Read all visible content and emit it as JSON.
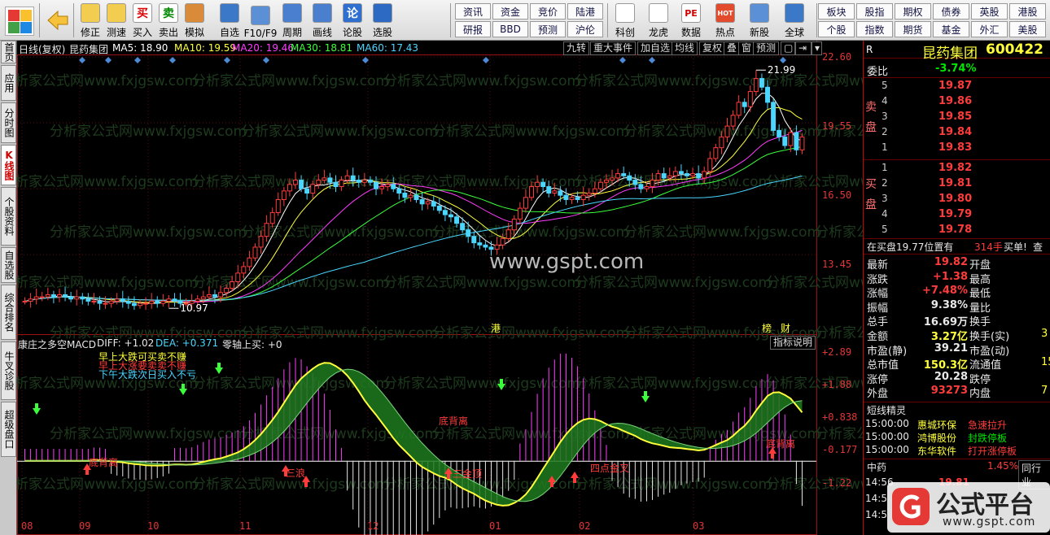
{
  "toolbar": {
    "buttons": [
      {
        "label": "修正",
        "icon": "arrow-up-icon"
      },
      {
        "label": "测速",
        "icon": "clock-icon"
      },
      {
        "label": "买入",
        "icon": "buy-icon",
        "glyph": "买"
      },
      {
        "label": "卖出",
        "icon": "sell-icon",
        "glyph": "卖"
      },
      {
        "label": "模拟",
        "icon": "hammer-icon"
      },
      {
        "label": "自选",
        "icon": "star-icon"
      },
      {
        "label": "F10/F9",
        "icon": "f10-icon"
      },
      {
        "label": "周期",
        "icon": "period-icon"
      },
      {
        "label": "画线",
        "icon": "pencil-icon"
      },
      {
        "label": "论股",
        "icon": "discuss-icon",
        "glyph": "论"
      },
      {
        "label": "选股",
        "icon": "gauge-icon"
      }
    ],
    "quick_top": [
      "资讯",
      "资金",
      "竞价",
      "陆港"
    ],
    "quick_bottom": [
      "研报",
      "BBD",
      "预测",
      "沪伦"
    ],
    "buttons2": [
      {
        "label": "科创",
        "icon": "chart-icon"
      },
      {
        "label": "龙虎",
        "icon": "dragon-icon"
      },
      {
        "label": "数据",
        "icon": "pe-icon",
        "glyph": "PE"
      },
      {
        "label": "热点",
        "icon": "hot-icon",
        "glyph": "HOT"
      },
      {
        "label": "新股",
        "icon": "ipo-icon"
      },
      {
        "label": "全球",
        "icon": "globe-icon"
      }
    ],
    "right_top": [
      "板块",
      "股指",
      "期权",
      "债券",
      "英股",
      "港股"
    ],
    "right_bottom": [
      "个股",
      "指数",
      "期货",
      "基金",
      "外汇",
      "美股"
    ]
  },
  "left_tabs": [
    "首页",
    "应用",
    "分时图",
    "K线图",
    "个股资料",
    "自选股",
    "综合排名",
    "牛叉诊股",
    "超级盘口"
  ],
  "chart_header": {
    "period": "日线(复权)",
    "stock": "昆药集团",
    "ma": [
      {
        "label": "MA5: 18.90",
        "color": "#ffffff"
      },
      {
        "label": "MA10: 19.59",
        "color": "#ffff3c"
      },
      {
        "label": "MA20: 19.46",
        "color": "#ff3cff"
      },
      {
        "label": "MA30: 18.81",
        "color": "#3cff3c"
      },
      {
        "label": "MA60: 17.43",
        "color": "#4ad6ff"
      }
    ],
    "buttons": [
      "九转",
      "重大事件",
      "加自选",
      "均线",
      "复权",
      "叠",
      "窗",
      "预测"
    ],
    "watermark": "www.gspt.com",
    "faint_watermark": "分析家公式网www.fxjgsw.com",
    "max_label": "21.99",
    "min_label": "10.97",
    "event_markers": [
      "港",
      "榜",
      "财"
    ]
  },
  "chart_data": [
    {
      "type": "candlestick",
      "title": "日线(复权) 昆药集团",
      "y_ticks": [
        "22.60",
        "19.55",
        "16.50",
        "13.45"
      ],
      "ylim": [
        10.0,
        22.6
      ],
      "x_ticks": [
        "08",
        "09",
        "10",
        "11",
        "12",
        "01",
        "02",
        "03"
      ],
      "series": [
        {
          "name": "MA5",
          "last": 18.9
        },
        {
          "name": "MA10",
          "last": 19.59
        },
        {
          "name": "MA20",
          "last": 19.46
        },
        {
          "name": "MA30",
          "last": 18.81
        },
        {
          "name": "MA60",
          "last": 17.43
        }
      ],
      "close": [
        11.3,
        11.4,
        11.5,
        11.5,
        11.6,
        11.5,
        11.6,
        11.5,
        11.4,
        11.5,
        11.4,
        11.3,
        11.3,
        11.2,
        11.2,
        11.3,
        11.4,
        11.3,
        11.2,
        11.1,
        11.2,
        11.2,
        11.3,
        11.2,
        11.3,
        11.4,
        11.3,
        11.2,
        11.2,
        11.3,
        11.4,
        11.5,
        11.6,
        11.5,
        11.7,
        11.9,
        12.2,
        12.6,
        12.9,
        13.3,
        13.8,
        14.3,
        14.9,
        15.4,
        16.0,
        16.4,
        16.7,
        16.9,
        16.5,
        16.3,
        16.7,
        16.9,
        17.0,
        16.8,
        16.6,
        16.9,
        17.1,
        16.9,
        16.8,
        16.9,
        16.8,
        16.5,
        16.6,
        16.7,
        16.5,
        16.3,
        16.1,
        16.2,
        16.0,
        15.8,
        15.9,
        15.7,
        15.5,
        15.3,
        15.2,
        14.9,
        14.6,
        14.3,
        14.0,
        13.9,
        13.8,
        13.7,
        13.9,
        14.2,
        14.6,
        15.1,
        15.6,
        16.1,
        16.6,
        16.8,
        16.6,
        16.3,
        16.4,
        16.2,
        16.0,
        16.1,
        16.0,
        16.2,
        16.3,
        16.5,
        16.8,
        16.9,
        17.0,
        17.2,
        17.1,
        16.9,
        16.7,
        16.5,
        16.6,
        16.9,
        17.2,
        17.0,
        17.1,
        17.3,
        17.2,
        17.1,
        17.2,
        17.0,
        17.3,
        17.9,
        18.4,
        18.9,
        19.4,
        19.9,
        20.5,
        20.3,
        21.0,
        21.6,
        21.2,
        20.5,
        19.2,
        18.9,
        18.5,
        19.1,
        18.3,
        18.9
      ],
      "macd": {
        "title": "康庄之多空MACD",
        "labels": [
          "DIFF: +1.02",
          "DEA: +0.371",
          "零轴上买: +0"
        ],
        "y_ticks": [
          "+2.89",
          "+1.88",
          "+0.838",
          "-0.177",
          "-1.22"
        ],
        "ylim": [
          -1.7,
          3.0
        ],
        "annotations": [
          "底背离",
          "底背离",
          "三金顶",
          "四点金叉",
          "底背离",
          "三浪"
        ],
        "signals": [
          "早上大跌可买卖不赚",
          "早上大涨要卖卖不赚",
          "下午大跌次日买入不亏"
        ]
      }
    }
  ],
  "indicator_button": "指标说明",
  "panel": {
    "name": "昆药集团",
    "code": "600422",
    "r": "R",
    "wb_label": "委比",
    "wb_value": "-3.74%",
    "sell_label": "卖盘",
    "buy_label": "买盘",
    "sell": [
      {
        "lv": "5",
        "p": "19.87"
      },
      {
        "lv": "4",
        "p": "19.86"
      },
      {
        "lv": "3",
        "p": "19.85"
      },
      {
        "lv": "2",
        "p": "19.84"
      },
      {
        "lv": "1",
        "p": "19.83"
      }
    ],
    "buy": [
      {
        "lv": "1",
        "p": "19.82"
      },
      {
        "lv": "2",
        "p": "19.81"
      },
      {
        "lv": "3",
        "p": "19.80"
      },
      {
        "lv": "4",
        "p": "19.79"
      },
      {
        "lv": "5",
        "p": "19.78"
      }
    ],
    "notice": {
      "text": "在买盘19.77位置有",
      "qty": "314手",
      "tag": "买单!",
      "btn": "查"
    },
    "stats": [
      {
        "l": "最新",
        "v": "19.82",
        "r": "开盘"
      },
      {
        "l": "涨跌",
        "v": "+1.38",
        "r": "最高"
      },
      {
        "l": "涨幅",
        "v": "+7.48%",
        "r": "最低"
      },
      {
        "l": "振幅",
        "v": "9.38%",
        "r": "量比"
      },
      {
        "l": "总手",
        "v": "16.69万",
        "r": "换手"
      },
      {
        "l": "金额",
        "v": "3.27亿",
        "r": "换手(实)",
        "tail": "3"
      },
      {
        "l": "市盈(静)",
        "v": "39.21",
        "r": "市盈(动)"
      },
      {
        "l": "总市值",
        "v": "150.3亿",
        "r": "流通值",
        "tail": "15"
      },
      {
        "l": "涨停",
        "v": "20.28",
        "r": "跌停"
      },
      {
        "l": "外盘",
        "v": "93273",
        "r": "内盘",
        "tail": "7"
      }
    ],
    "short_title": "短线精灵",
    "tape": [
      {
        "t": "15:00:00",
        "n": "惠城环保",
        "e": "急速拉升"
      },
      {
        "t": "15:00:00",
        "n": "鸿博股份",
        "e": "封跌停板"
      },
      {
        "t": "15:00:00",
        "n": "东华软件",
        "e": "打开涨停板"
      }
    ],
    "sector": {
      "name": "中药",
      "pct": "1.45%",
      "btn": "同行业"
    },
    "time_rows": [
      "14:56",
      "14:5",
      "14:5"
    ],
    "time_price": "19.81"
  },
  "watermark_badge": {
    "text": "公式平台",
    "url": "www.gspt.com"
  },
  "colors": {
    "up": "#ff3c3c",
    "down": "#4ad6ff",
    "accent": "#c00000",
    "bg": "#000000"
  }
}
